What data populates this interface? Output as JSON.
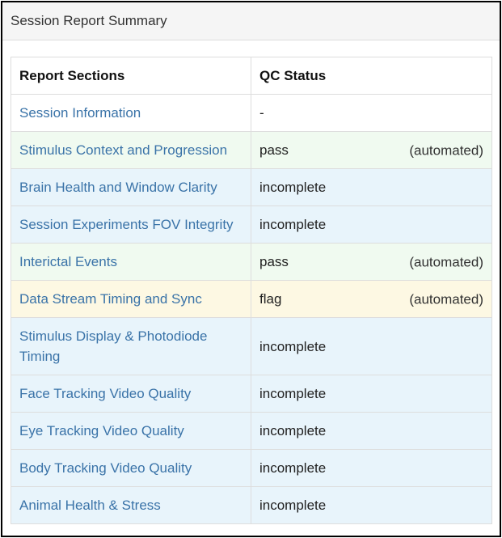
{
  "panel": {
    "title": "Session Report Summary"
  },
  "table": {
    "headers": {
      "sections": "Report Sections",
      "status": "QC Status"
    },
    "rows": [
      {
        "section": "Session Information",
        "status": "-",
        "note": "",
        "state": "neutral"
      },
      {
        "section": "Stimulus Context and Progression",
        "status": "pass",
        "note": "(automated)",
        "state": "pass"
      },
      {
        "section": "Brain Health and Window Clarity",
        "status": "incomplete",
        "note": "",
        "state": "incomplete"
      },
      {
        "section": "Session Experiments FOV Integrity",
        "status": "incomplete",
        "note": "",
        "state": "incomplete"
      },
      {
        "section": "Interictal Events",
        "status": "pass",
        "note": "(automated)",
        "state": "pass"
      },
      {
        "section": "Data Stream Timing and Sync",
        "status": "flag",
        "note": "(automated)",
        "state": "flag"
      },
      {
        "section": "Stimulus Display & Photodiode Timing",
        "status": "incomplete",
        "note": "",
        "state": "incomplete"
      },
      {
        "section": "Face Tracking Video Quality",
        "status": "incomplete",
        "note": "",
        "state": "incomplete"
      },
      {
        "section": "Eye Tracking Video Quality",
        "status": "incomplete",
        "note": "",
        "state": "incomplete"
      },
      {
        "section": "Body Tracking Video Quality",
        "status": "incomplete",
        "note": "",
        "state": "incomplete"
      },
      {
        "section": "Animal Health & Stress",
        "status": "incomplete",
        "note": "",
        "state": "incomplete"
      }
    ]
  },
  "colors": {
    "link": "#3a73a8",
    "pass_bg": "#f0faf0",
    "flag_bg": "#fdf8e3",
    "incomplete_bg": "#e8f4fb",
    "heading_bg": "#f5f5f5"
  }
}
